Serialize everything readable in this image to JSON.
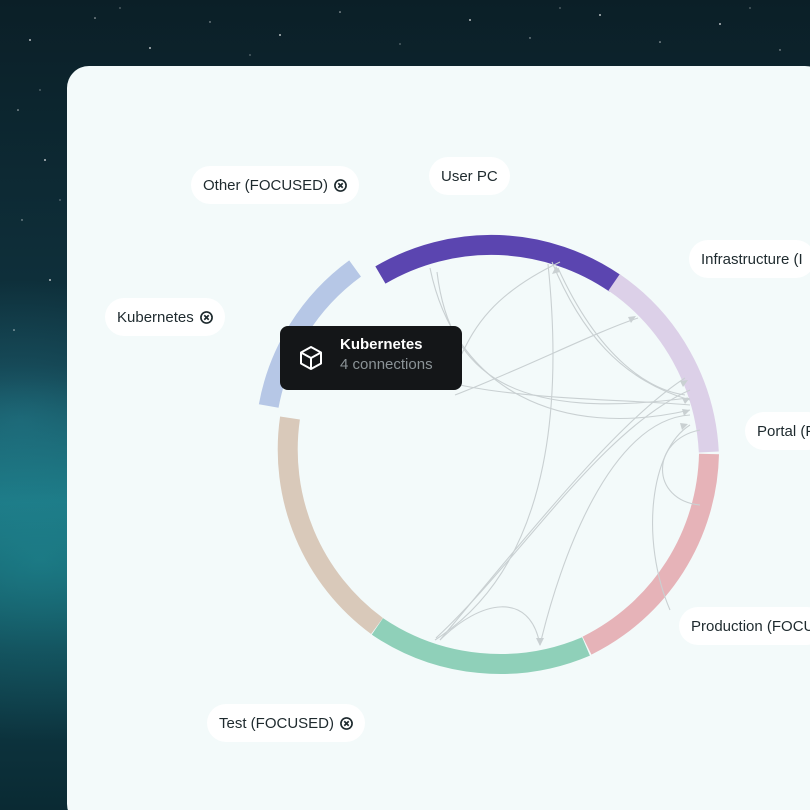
{
  "nodes": {
    "other": "Other (FOCUSED)",
    "user_pc": "User PC",
    "infrastructure": "Infrastructure (I",
    "kubernetes": "Kubernetes",
    "portal": "Portal (F",
    "production": "Production (FOCU",
    "test": "Test (FOCUSED)"
  },
  "tooltip": {
    "title": "Kubernetes",
    "subtitle": "4 connections",
    "icon": "cube-icon"
  },
  "colors": {
    "user_pc": "#5b45b0",
    "infrastructure": "#dcd0e8",
    "portal": "#dccfe6",
    "production": "#e6b3b8",
    "test": "#8fd0b9",
    "misc": "#d9c9ba",
    "kubernetes": "#b6c7e6",
    "tooltip_bg": "#141618",
    "panel_bg": "#f3fafa"
  }
}
